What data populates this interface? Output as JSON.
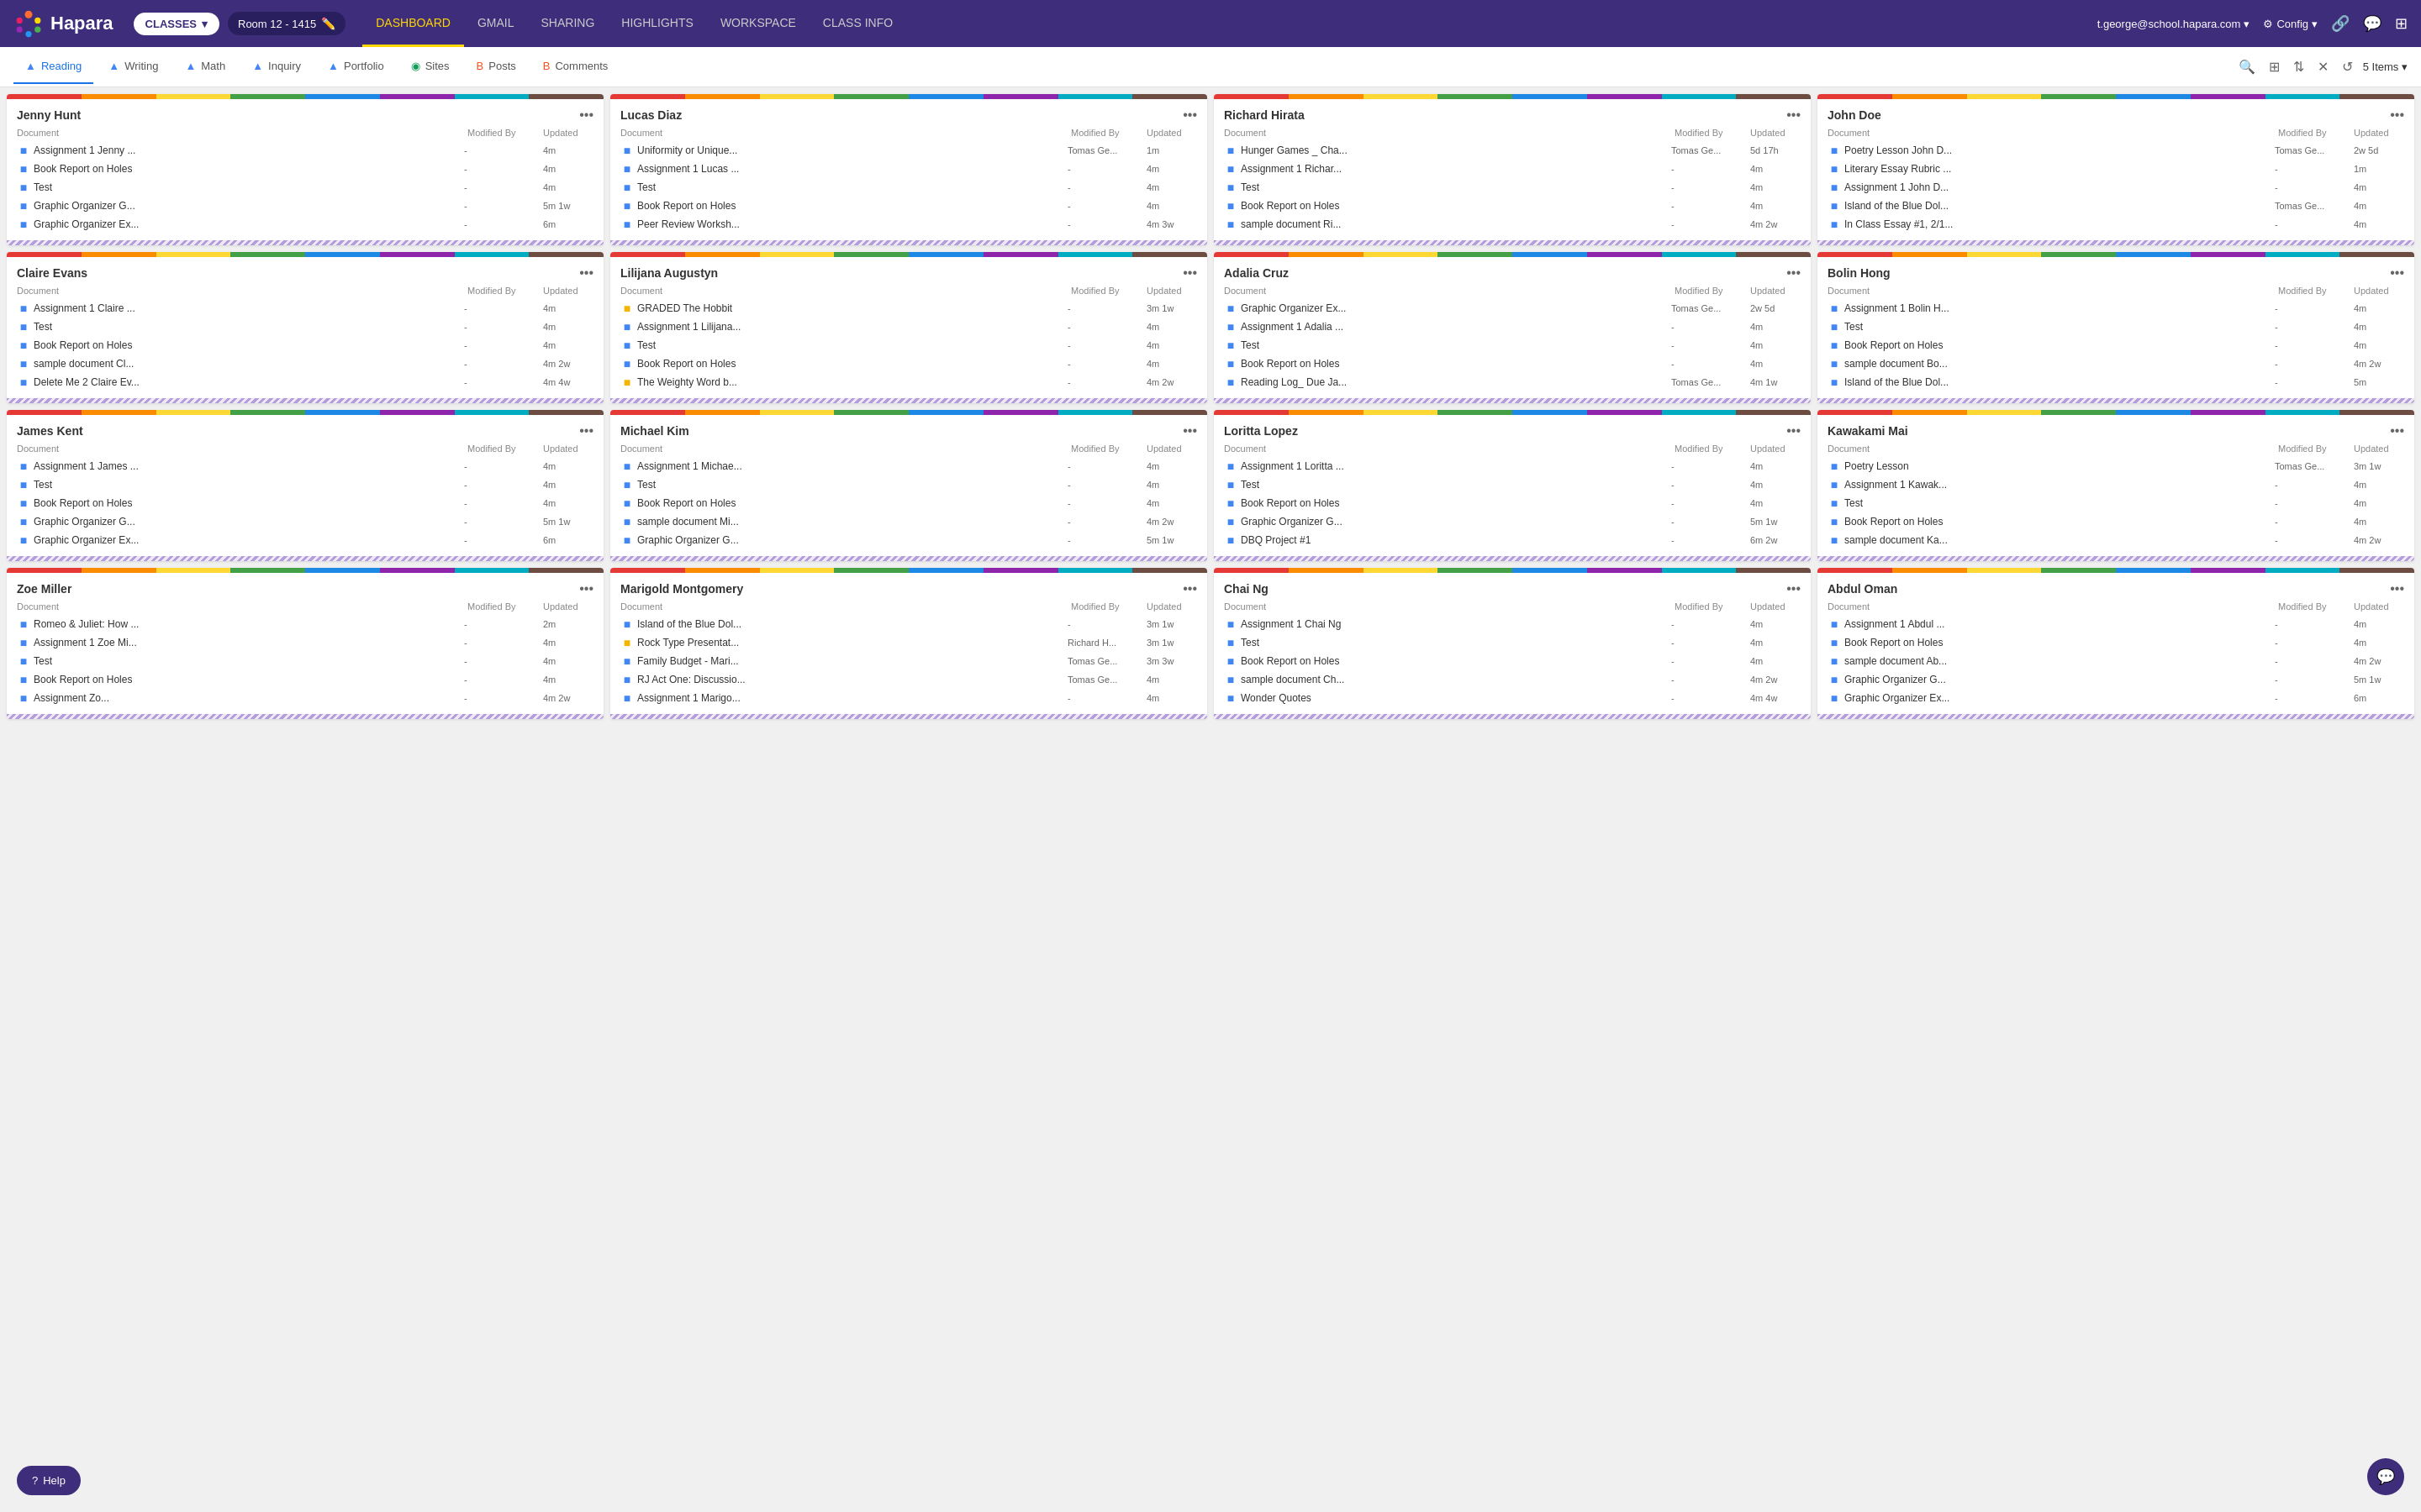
{
  "topbar": {
    "logo": "Hapara",
    "classes_btn": "CLASSES",
    "room": "Room 12 - 1415",
    "user": "t.george@school.hapara.com",
    "config": "Config",
    "nav": [
      {
        "label": "DASHBOARD",
        "active": true
      },
      {
        "label": "GMAIL"
      },
      {
        "label": "SHARING"
      },
      {
        "label": "HIGHLIGHTS"
      },
      {
        "label": "WORKSPACE"
      },
      {
        "label": "CLASS INFO"
      }
    ]
  },
  "subnav": {
    "tabs": [
      {
        "label": "Reading",
        "active": true,
        "icon": "drive"
      },
      {
        "label": "Writing",
        "icon": "drive"
      },
      {
        "label": "Math",
        "icon": "drive"
      },
      {
        "label": "Inquiry",
        "icon": "drive"
      },
      {
        "label": "Portfolio",
        "icon": "drive"
      },
      {
        "label": "Sites",
        "icon": "sites"
      },
      {
        "label": "Posts",
        "icon": "blogger"
      },
      {
        "label": "Comments",
        "icon": "blogger"
      }
    ],
    "items_count": "5 Items"
  },
  "students": [
    {
      "name": "Jenny Hunt",
      "docs": [
        {
          "title": "Assignment 1 Jenny ...",
          "modified_by": "-",
          "updated": "4m",
          "type": "doc"
        },
        {
          "title": "Book Report on Holes",
          "modified_by": "-",
          "updated": "4m",
          "type": "doc"
        },
        {
          "title": "Test",
          "modified_by": "-",
          "updated": "4m",
          "type": "doc"
        },
        {
          "title": "Graphic Organizer G...",
          "modified_by": "-",
          "updated": "5m 1w",
          "type": "doc"
        },
        {
          "title": "Graphic Organizer Ex...",
          "modified_by": "-",
          "updated": "6m",
          "type": "doc"
        }
      ]
    },
    {
      "name": "Lucas Diaz",
      "docs": [
        {
          "title": "Uniformity or Unique...",
          "modified_by": "Tomas Ge...",
          "updated": "1m",
          "type": "doc"
        },
        {
          "title": "Assignment 1 Lucas ...",
          "modified_by": "-",
          "updated": "4m",
          "type": "doc"
        },
        {
          "title": "Test",
          "modified_by": "-",
          "updated": "4m",
          "type": "doc"
        },
        {
          "title": "Book Report on Holes",
          "modified_by": "-",
          "updated": "4m",
          "type": "doc"
        },
        {
          "title": "Peer Review Worksh...",
          "modified_by": "-",
          "updated": "4m 3w",
          "type": "doc"
        }
      ]
    },
    {
      "name": "Richard Hirata",
      "docs": [
        {
          "title": "Hunger Games _ Cha...",
          "modified_by": "Tomas Ge...",
          "updated": "5d 17h",
          "type": "doc"
        },
        {
          "title": "Assignment 1 Richar...",
          "modified_by": "-",
          "updated": "4m",
          "type": "doc"
        },
        {
          "title": "Test",
          "modified_by": "-",
          "updated": "4m",
          "type": "doc"
        },
        {
          "title": "Book Report on Holes",
          "modified_by": "-",
          "updated": "4m",
          "type": "doc"
        },
        {
          "title": "sample document Ri...",
          "modified_by": "-",
          "updated": "4m 2w",
          "type": "doc"
        }
      ]
    },
    {
      "name": "John Doe",
      "docs": [
        {
          "title": "Poetry Lesson John D...",
          "modified_by": "Tomas Ge...",
          "updated": "2w 5d",
          "type": "doc"
        },
        {
          "title": "Literary Essay Rubric ...",
          "modified_by": "-",
          "updated": "1m",
          "type": "doc"
        },
        {
          "title": "Assignment 1 John D...",
          "modified_by": "-",
          "updated": "4m",
          "type": "doc"
        },
        {
          "title": "Island of the Blue Dol...",
          "modified_by": "Tomas Ge...",
          "updated": "4m",
          "type": "doc"
        },
        {
          "title": "In Class Essay #1, 2/1...",
          "modified_by": "-",
          "updated": "4m",
          "type": "doc"
        }
      ]
    },
    {
      "name": "Claire Evans",
      "docs": [
        {
          "title": "Assignment 1 Claire ...",
          "modified_by": "-",
          "updated": "4m",
          "type": "doc"
        },
        {
          "title": "Test",
          "modified_by": "-",
          "updated": "4m",
          "type": "doc"
        },
        {
          "title": "Book Report on Holes",
          "modified_by": "-",
          "updated": "4m",
          "type": "doc"
        },
        {
          "title": "sample document Cl...",
          "modified_by": "-",
          "updated": "4m 2w",
          "type": "doc"
        },
        {
          "title": "Delete Me 2 Claire Ev...",
          "modified_by": "-",
          "updated": "4m 4w",
          "type": "doc"
        }
      ]
    },
    {
      "name": "Lilijana Augustyn",
      "docs": [
        {
          "title": "GRADED The Hobbit",
          "modified_by": "-",
          "updated": "3m 1w",
          "type": "slides"
        },
        {
          "title": "Assignment 1 Lilijana...",
          "modified_by": "-",
          "updated": "4m",
          "type": "doc"
        },
        {
          "title": "Test",
          "modified_by": "-",
          "updated": "4m",
          "type": "doc"
        },
        {
          "title": "Book Report on Holes",
          "modified_by": "-",
          "updated": "4m",
          "type": "doc"
        },
        {
          "title": "The Weighty Word b...",
          "modified_by": "-",
          "updated": "4m 2w",
          "type": "slides"
        }
      ]
    },
    {
      "name": "Adalia Cruz",
      "docs": [
        {
          "title": "Graphic Organizer Ex...",
          "modified_by": "Tomas Ge...",
          "updated": "2w 5d",
          "type": "doc"
        },
        {
          "title": "Assignment 1 Adalia ...",
          "modified_by": "-",
          "updated": "4m",
          "type": "doc"
        },
        {
          "title": "Test",
          "modified_by": "-",
          "updated": "4m",
          "type": "doc"
        },
        {
          "title": "Book Report on Holes",
          "modified_by": "-",
          "updated": "4m",
          "type": "doc"
        },
        {
          "title": "Reading Log_ Due Ja...",
          "modified_by": "Tomas Ge...",
          "updated": "4m 1w",
          "type": "doc"
        }
      ]
    },
    {
      "name": "Bolin Hong",
      "docs": [
        {
          "title": "Assignment 1 Bolin H...",
          "modified_by": "-",
          "updated": "4m",
          "type": "doc"
        },
        {
          "title": "Test",
          "modified_by": "-",
          "updated": "4m",
          "type": "doc"
        },
        {
          "title": "Book Report on Holes",
          "modified_by": "-",
          "updated": "4m",
          "type": "doc"
        },
        {
          "title": "sample document Bo...",
          "modified_by": "-",
          "updated": "4m 2w",
          "type": "doc"
        },
        {
          "title": "Island of the Blue Dol...",
          "modified_by": "-",
          "updated": "5m",
          "type": "doc"
        }
      ]
    },
    {
      "name": "James Kent",
      "docs": [
        {
          "title": "Assignment 1 James ...",
          "modified_by": "-",
          "updated": "4m",
          "type": "doc"
        },
        {
          "title": "Test",
          "modified_by": "-",
          "updated": "4m",
          "type": "doc"
        },
        {
          "title": "Book Report on Holes",
          "modified_by": "-",
          "updated": "4m",
          "type": "doc"
        },
        {
          "title": "Graphic Organizer G...",
          "modified_by": "-",
          "updated": "5m 1w",
          "type": "doc"
        },
        {
          "title": "Graphic Organizer Ex...",
          "modified_by": "-",
          "updated": "6m",
          "type": "doc"
        }
      ]
    },
    {
      "name": "Michael Kim",
      "docs": [
        {
          "title": "Assignment 1 Michae...",
          "modified_by": "-",
          "updated": "4m",
          "type": "doc"
        },
        {
          "title": "Test",
          "modified_by": "-",
          "updated": "4m",
          "type": "doc"
        },
        {
          "title": "Book Report on Holes",
          "modified_by": "-",
          "updated": "4m",
          "type": "doc"
        },
        {
          "title": "sample document Mi...",
          "modified_by": "-",
          "updated": "4m 2w",
          "type": "doc"
        },
        {
          "title": "Graphic Organizer G...",
          "modified_by": "-",
          "updated": "5m 1w",
          "type": "doc"
        }
      ]
    },
    {
      "name": "Loritta Lopez",
      "docs": [
        {
          "title": "Assignment 1 Loritta ...",
          "modified_by": "-",
          "updated": "4m",
          "type": "doc"
        },
        {
          "title": "Test",
          "modified_by": "-",
          "updated": "4m",
          "type": "doc"
        },
        {
          "title": "Book Report on Holes",
          "modified_by": "-",
          "updated": "4m",
          "type": "doc"
        },
        {
          "title": "Graphic Organizer G...",
          "modified_by": "-",
          "updated": "5m 1w",
          "type": "doc"
        },
        {
          "title": "DBQ Project #1",
          "modified_by": "-",
          "updated": "6m 2w",
          "type": "doc"
        }
      ]
    },
    {
      "name": "Kawakami Mai",
      "docs": [
        {
          "title": "Poetry Lesson",
          "modified_by": "Tomas Ge...",
          "updated": "3m 1w",
          "type": "doc"
        },
        {
          "title": "Assignment 1 Kawak...",
          "modified_by": "-",
          "updated": "4m",
          "type": "doc"
        },
        {
          "title": "Test",
          "modified_by": "-",
          "updated": "4m",
          "type": "doc"
        },
        {
          "title": "Book Report on Holes",
          "modified_by": "-",
          "updated": "4m",
          "type": "doc"
        },
        {
          "title": "sample document Ka...",
          "modified_by": "-",
          "updated": "4m 2w",
          "type": "doc"
        }
      ]
    },
    {
      "name": "Zoe Miller",
      "docs": [
        {
          "title": "Romeo & Juliet: How ...",
          "modified_by": "-",
          "updated": "2m",
          "type": "doc"
        },
        {
          "title": "Assignment 1 Zoe Mi...",
          "modified_by": "-",
          "updated": "4m",
          "type": "doc"
        },
        {
          "title": "Test",
          "modified_by": "-",
          "updated": "4m",
          "type": "doc"
        },
        {
          "title": "Book Report on Holes",
          "modified_by": "-",
          "updated": "4m",
          "type": "doc"
        },
        {
          "title": "Assignment Zo...",
          "modified_by": "-",
          "updated": "4m 2w",
          "type": "doc"
        }
      ]
    },
    {
      "name": "Marigold Montgomery",
      "docs": [
        {
          "title": "Island of the Blue Dol...",
          "modified_by": "-",
          "updated": "3m 1w",
          "type": "doc"
        },
        {
          "title": "Rock Type Presentat...",
          "modified_by": "Richard H...",
          "updated": "3m 1w",
          "type": "slides"
        },
        {
          "title": "Family Budget - Mari...",
          "modified_by": "Tomas Ge...",
          "updated": "3m 3w",
          "type": "doc"
        },
        {
          "title": "RJ Act One: Discussio...",
          "modified_by": "Tomas Ge...",
          "updated": "4m",
          "type": "doc"
        },
        {
          "title": "Assignment 1 Marigo...",
          "modified_by": "-",
          "updated": "4m",
          "type": "doc"
        }
      ]
    },
    {
      "name": "Chai Ng",
      "docs": [
        {
          "title": "Assignment 1 Chai Ng",
          "modified_by": "-",
          "updated": "4m",
          "type": "doc"
        },
        {
          "title": "Test",
          "modified_by": "-",
          "updated": "4m",
          "type": "doc"
        },
        {
          "title": "Book Report on Holes",
          "modified_by": "-",
          "updated": "4m",
          "type": "doc"
        },
        {
          "title": "sample document Ch...",
          "modified_by": "-",
          "updated": "4m 2w",
          "type": "doc"
        },
        {
          "title": "Wonder Quotes",
          "modified_by": "-",
          "updated": "4m 4w",
          "type": "doc"
        }
      ]
    },
    {
      "name": "Abdul Oman",
      "docs": [
        {
          "title": "Assignment 1 Abdul ...",
          "modified_by": "-",
          "updated": "4m",
          "type": "doc"
        },
        {
          "title": "Book Report on Holes",
          "modified_by": "-",
          "updated": "4m",
          "type": "doc"
        },
        {
          "title": "sample document Ab...",
          "modified_by": "-",
          "updated": "4m 2w",
          "type": "doc"
        },
        {
          "title": "Graphic Organizer G...",
          "modified_by": "-",
          "updated": "5m 1w",
          "type": "doc"
        },
        {
          "title": "Graphic Organizer Ex...",
          "modified_by": "-",
          "updated": "6m",
          "type": "doc"
        }
      ]
    }
  ],
  "labels": {
    "document": "Document",
    "modified_by": "Modified By",
    "updated": "Updated",
    "help": "Help",
    "classes_chevron": "▾",
    "more": "•••"
  }
}
